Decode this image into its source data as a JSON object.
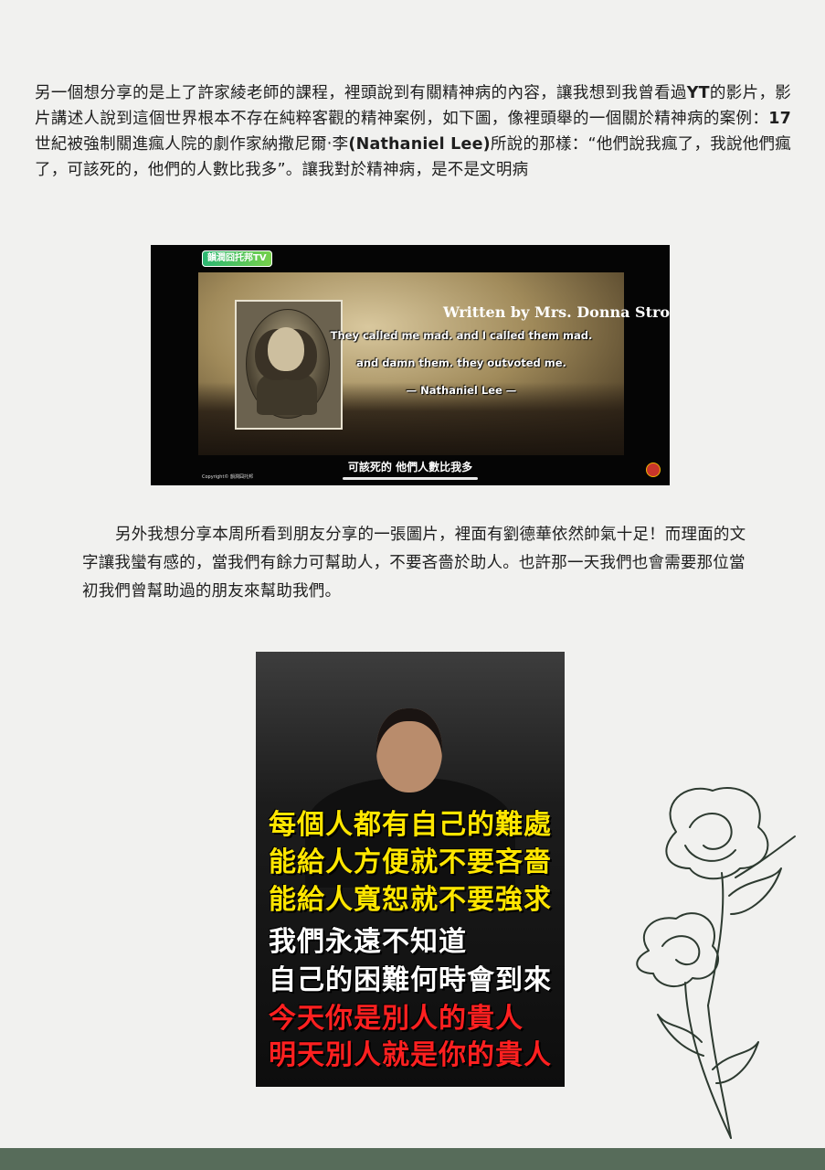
{
  "paragraph1": {
    "s1": "另一個想分享的是上了許家綾老師的課程，裡頭說到有關精神病的內容，讓我想到我曾看過",
    "s2": "YT",
    "s3": "的影片，影片講述人說到這個世界根本不存在純粹客觀的精神案例，如下圖，像裡頭舉的一個關於精神病的案例：",
    "s4": "17",
    "s5": "世紀被強制關進瘋人院的劇作家納撒尼爾‧李",
    "s6": "(Nathaniel Lee)",
    "s7": "所說的那樣：“他們說我瘋了，我說他們瘋了，可該死的，他們的人數比我多”。讓我對於精神病，是不是文明病"
  },
  "video": {
    "logo": "韻潤囧托邦TV",
    "written_by": "Written by Mrs. Donna Stroupe",
    "quote_line1": "They called me mad. and I called them mad.",
    "quote_line2": "and damn them. they outvoted me.",
    "quote_line3": "— Nathaniel Lee —",
    "subtitle": "可該死的 他們人數比我多",
    "copyright": "Copyright© 韻潤囧托邦"
  },
  "paragraph2": {
    "text": "另外我想分享本周所看到朋友分享的一張圖片，裡面有劉德華依然帥氣十足！而理面的文字讓我蠻有感的，當我們有餘力可幫助人，不要吝嗇於助人。也許那一天我們也會需要那位當初我們曾幫助過的朋友來幫助我們。"
  },
  "poster": {
    "lines": [
      "每個人都有自己的難處",
      "能給人方便就不要吝嗇",
      "能給人寬恕就不要強求",
      "我們永遠不知道",
      "自己的困難何時會到來",
      "今天你是別人的貴人",
      "明天別人就是你的貴人"
    ]
  },
  "colors": {
    "background": "#f1f1ef",
    "footer_band": "#576c5a",
    "poster_yellow": "#ffe600",
    "poster_red": "#ff2020"
  }
}
